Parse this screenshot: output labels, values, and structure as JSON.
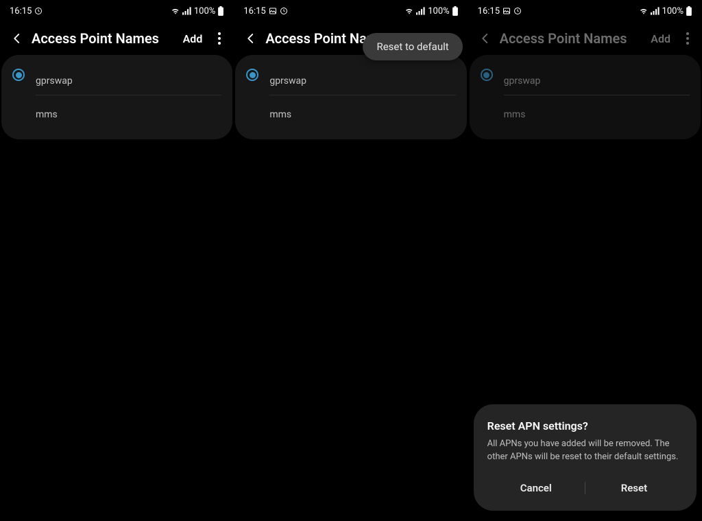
{
  "screens": [
    {
      "status": {
        "time": "16:15",
        "battery": "100%",
        "icons_left": [
          "clock"
        ],
        "icons_right": [
          "wifi",
          "signal"
        ]
      },
      "header": {
        "title": "Access Point Names",
        "add": "Add"
      },
      "apns": [
        {
          "name": "gprswap",
          "selected": true
        },
        {
          "name": "mms",
          "selected": false
        }
      ]
    },
    {
      "status": {
        "time": "16:15",
        "battery": "100%",
        "icons_left": [
          "image",
          "clock"
        ],
        "icons_right": [
          "wifi",
          "signal"
        ]
      },
      "header": {
        "title": "Access Point Nam",
        "add": ""
      },
      "popup": {
        "reset_default": "Reset to default"
      },
      "apns": [
        {
          "name": "gprswap",
          "selected": true
        },
        {
          "name": "mms",
          "selected": false
        }
      ]
    },
    {
      "status": {
        "time": "16:15",
        "battery": "100%",
        "icons_left": [
          "image",
          "clock"
        ],
        "icons_right": [
          "wifi",
          "signal"
        ]
      },
      "header": {
        "title": "Access Point Names",
        "add": "Add"
      },
      "dimmed": true,
      "apns": [
        {
          "name": "gprswap",
          "selected": true
        },
        {
          "name": "mms",
          "selected": false
        }
      ],
      "dialog": {
        "title": "Reset APN settings?",
        "body": "All APNs you have added will be removed. The other APNs will be reset to their default settings.",
        "cancel": "Cancel",
        "confirm": "Reset"
      }
    }
  ]
}
